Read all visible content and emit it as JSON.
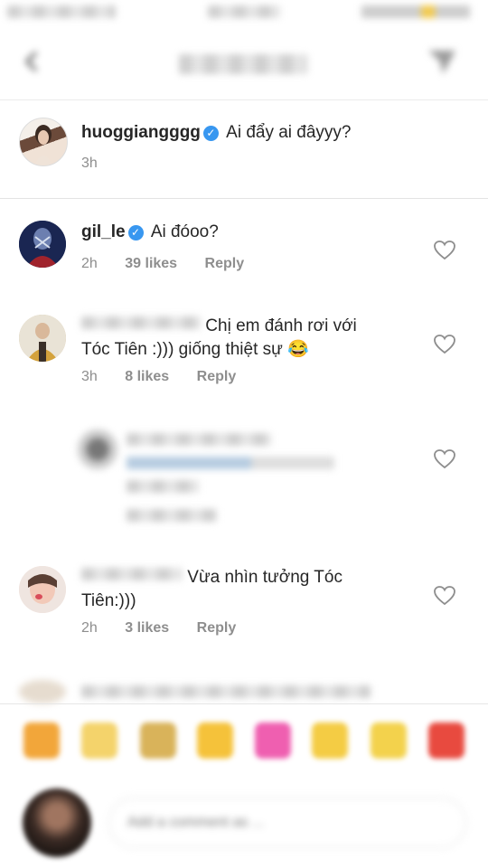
{
  "header": {
    "title_redacted": "Comments",
    "back_icon": "chevron-left-icon",
    "share_icon": "direct-send-icon"
  },
  "comments": [
    {
      "username": "huoggiangggg",
      "verified": true,
      "text": "Ai đẩy ai đâyyy?",
      "time": "3h"
    },
    {
      "username": "gil_le",
      "verified": true,
      "text": "Ai đóoo?",
      "time": "2h",
      "likes": "39 likes",
      "reply": "Reply"
    },
    {
      "username_redacted": "sarahkhanh_nt",
      "text": "Chị em đánh rơi với Tóc Tiên :))) giống thiệt sự 😂",
      "time": "3h",
      "likes": "8 likes",
      "reply": "Reply"
    },
    {
      "redacted": true
    },
    {
      "username_redacted": "username",
      "text": "Vừa nhìn tưởng Tóc Tiên:)))",
      "time": "2h",
      "likes": "3 likes",
      "reply": "Reply"
    }
  ],
  "colors": {
    "verified": "#3897f0",
    "meta": "#8e8e8e",
    "text": "#262626"
  },
  "reactions": [
    "😂",
    "😍",
    "👏",
    "😂",
    "💖",
    "😂",
    "😂",
    "❤️"
  ],
  "input": {
    "placeholder": "Add a comment as ..."
  }
}
